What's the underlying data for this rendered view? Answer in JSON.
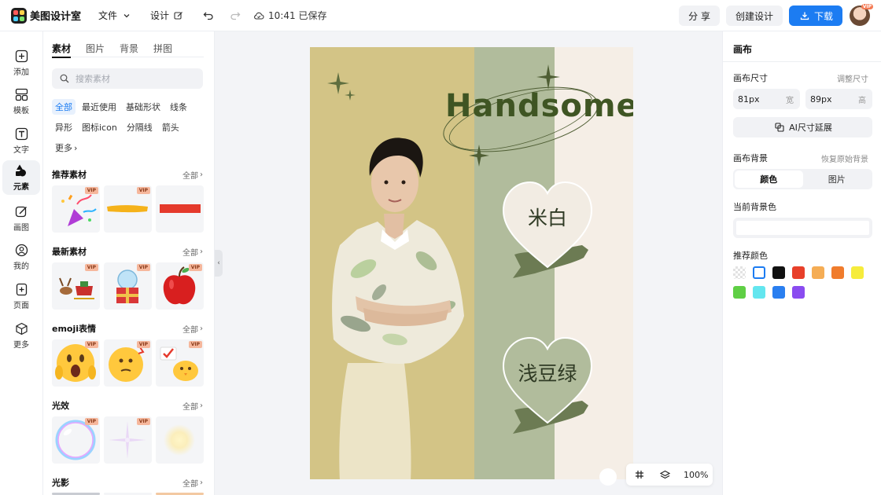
{
  "app": {
    "name": "美图设计室",
    "menu": {
      "file": "文件",
      "design": "设计"
    },
    "save_status": "10:41 已保存",
    "share_label": "分 享",
    "create_label": "创建设计",
    "download_label": "下载",
    "avatar_badge": "VIP"
  },
  "rail": [
    {
      "label": "添加",
      "icon": "plus-square-icon"
    },
    {
      "label": "模板",
      "icon": "template-icon"
    },
    {
      "label": "文字",
      "icon": "text-icon"
    },
    {
      "label": "元素",
      "icon": "shapes-icon",
      "active": true
    },
    {
      "label": "画图",
      "icon": "draw-icon"
    },
    {
      "label": "我的",
      "icon": "user-icon"
    },
    {
      "label": "页面",
      "icon": "page-add-icon"
    },
    {
      "label": "更多",
      "icon": "cube-icon"
    }
  ],
  "panel": {
    "tabs": [
      "素材",
      "图片",
      "背景",
      "拼图"
    ],
    "active_tab": "素材",
    "search_placeholder": "搜索素材",
    "chips": [
      "全部",
      "最近使用",
      "基础形状",
      "线条",
      "异形",
      "图标icon",
      "分隔线",
      "箭头",
      "更多"
    ],
    "active_chip": "全部",
    "vip_label": "VIP",
    "sections": [
      {
        "title": "推荐素材",
        "more": "全部"
      },
      {
        "title": "最新素材",
        "more": "全部"
      },
      {
        "title": "emoji表情",
        "more": "全部"
      },
      {
        "title": "光效",
        "more": "全部"
      },
      {
        "title": "光影",
        "more": "全部"
      }
    ]
  },
  "canvas": {
    "headline": "Handsome",
    "heart1": "米白",
    "heart2": "浅豆绿",
    "colors": {
      "col1": "#d3c486",
      "col2": "#b1bc9c",
      "col3": "#f5eee6",
      "headline": "#3f5523",
      "brush": "#6c7b53"
    }
  },
  "zoom": {
    "level": "100%"
  },
  "right": {
    "title": "画布",
    "size_label": "画布尺寸",
    "size_hint": "调整尺寸",
    "width_value": "81px",
    "width_unit": "宽",
    "height_value": "89px",
    "height_unit": "高",
    "ai_button": "AI尺寸延展",
    "bg_label": "画布背景",
    "bg_hint": "恢复原始背景",
    "seg_color": "颜色",
    "seg_image": "图片",
    "current_bg_label": "当前背景色",
    "recommend_label": "推荐颜色",
    "swatches": [
      "transparent",
      "#ffffff",
      "#111111",
      "#e8402a",
      "#f5ad55",
      "#f07c2d",
      "#f6ec3c",
      "#5fcf45",
      "#63e6ef",
      "#2a7ff0",
      "#8a4cf0"
    ]
  },
  "accent": "#1c7cf2"
}
